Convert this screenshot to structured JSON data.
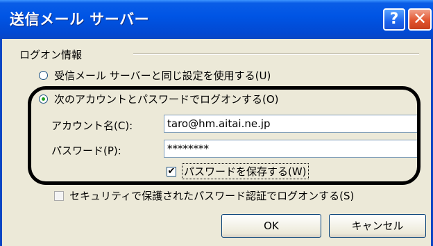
{
  "window": {
    "title": "送信メール サーバー",
    "help_glyph": "?",
    "close_glyph": "✕"
  },
  "group": {
    "label": "ログオン情報"
  },
  "options": {
    "same_settings_label": "受信メール サーバーと同じ設定を使用する(U)",
    "logon_with_label": "次のアカウントとパスワードでログオンする(O)",
    "spa_label": "セキュリティで保護されたパスワード認証でログオンする(S)"
  },
  "account": {
    "label": "アカウント名(C):",
    "value": "taro@hm.aitai.ne.jp"
  },
  "password": {
    "label": "パスワード(P):",
    "value": "********"
  },
  "remember_password": {
    "label": "パスワードを保存する(W)",
    "checked": true,
    "check_glyph": "✔"
  },
  "buttons": {
    "ok": "OK",
    "cancel": "キャンセル"
  },
  "colors": {
    "titlebar": "#0055e5",
    "dialog_bg": "#ece9d8",
    "radio_dot": "#21a121",
    "highlight_ring": "#000000"
  },
  "icons": {
    "help": "help-icon",
    "close": "close-icon",
    "check": "checkmark-icon"
  }
}
